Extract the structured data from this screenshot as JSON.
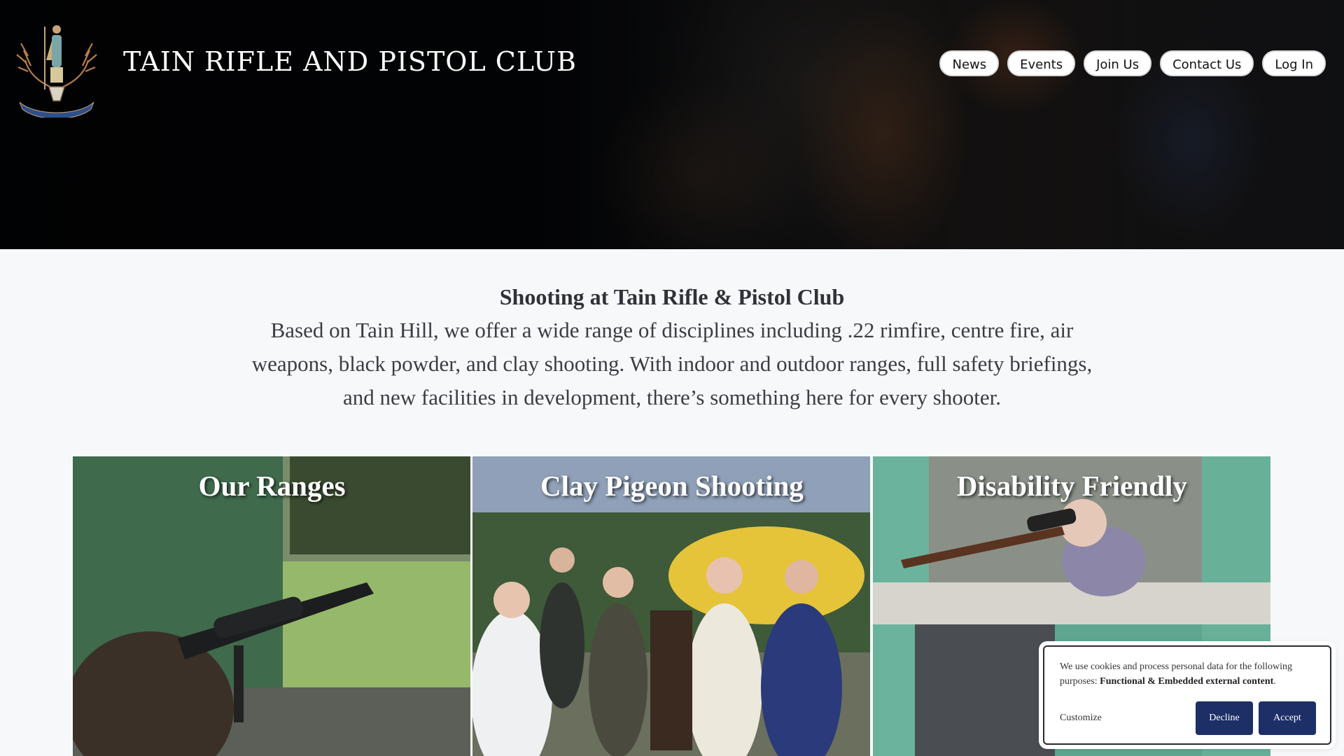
{
  "header": {
    "title": "TAIN RIFLE AND PISTOL CLUB",
    "logo_icon": "stag-crest-logo",
    "nav": [
      {
        "label": "News"
      },
      {
        "label": "Events"
      },
      {
        "label": "Join Us"
      },
      {
        "label": "Contact Us"
      },
      {
        "label": "Log In"
      }
    ]
  },
  "intro": {
    "heading": "Shooting at Tain Rifle & Pistol Club",
    "body": "Based on Tain Hill, we offer a wide range of disciplines including .22 rimfire, centre fire, air weapons, black powder, and clay shooting. With indoor and outdoor ranges, full safety briefings, and new facilities in development, there’s something here for every shooter."
  },
  "cards": [
    {
      "title": "Our Ranges"
    },
    {
      "title": "Clay Pigeon Shooting"
    },
    {
      "title": "Disability Friendly"
    }
  ],
  "cookie": {
    "text_prefix": "We use cookies and process personal data for the following purposes: ",
    "text_bold": "Functional & Embedded external content",
    "text_suffix": ".",
    "customize_label": "Customize",
    "decline_label": "Decline",
    "accept_label": "Accept",
    "button_color": "#1d2f66"
  }
}
